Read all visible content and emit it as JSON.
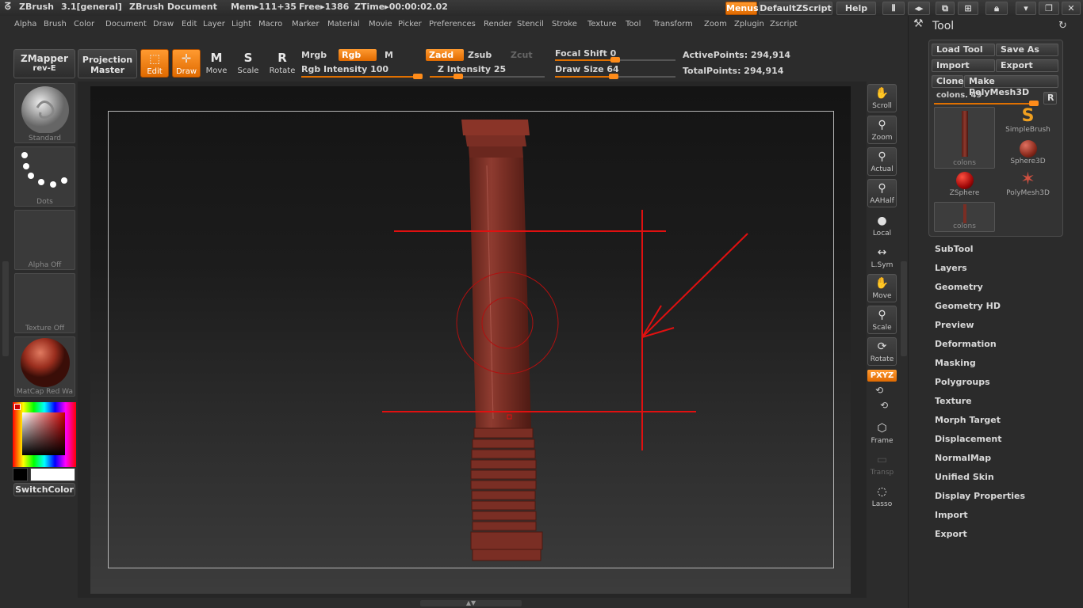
{
  "title_bar": {
    "app": "ZBrush",
    "version": "3.1[general]",
    "document": "ZBrush Document",
    "mem": "Mem▸111+35",
    "free": "Free▸1386",
    "ztime": "ZTime▸00:00:02.02",
    "menus_btn": "Menus",
    "script_btn": "DefaultZScript",
    "help_btn": "Help"
  },
  "menu_bar": [
    "Alpha",
    "Brush",
    "Color",
    "Document",
    "Draw",
    "Edit",
    "Layer",
    "Light",
    "Macro",
    "Marker",
    "Material",
    "Movie",
    "Picker",
    "Preferences",
    "Render",
    "Stencil",
    "Stroke",
    "Texture",
    "Tool",
    "Transform",
    "Zoom",
    "Zplugin",
    "Zscript"
  ],
  "toolbar": {
    "zmapper": "ZMapper",
    "zmapper_sub": "rev-E",
    "projection": "Projection",
    "projection_sub": "Master",
    "edit": "Edit",
    "draw": "Draw",
    "move": "Move",
    "scale": "Scale",
    "rotate": "Rotate",
    "mrgb": "Mrgb",
    "rgb": "Rgb",
    "m": "M",
    "rgb_intensity": "Rgb Intensity 100",
    "zadd": "Zadd",
    "zsub": "Zsub",
    "zcut": "Zcut",
    "z_intensity": "Z Intensity 25",
    "focal_shift": "Focal Shift 0",
    "draw_size": "Draw Size 64",
    "active_points": "ActivePoints: 294,914",
    "total_points": "TotalPoints: 294,914",
    "rgb_intensity_value": 100,
    "z_intensity_value": 25,
    "focal_shift_value": 0,
    "draw_size_value": 64
  },
  "left_shelf": {
    "brush": "Standard",
    "stroke": "Dots",
    "alpha": "Alpha  Off",
    "texture": "Texture  Off",
    "material": "MatCap  Red  Wa",
    "switch_color": "SwitchColor"
  },
  "right_strip": [
    "Scroll",
    "Zoom",
    "Actual",
    "AAHalf",
    "Local",
    "L.Sym",
    "Move",
    "Scale",
    "Rotate",
    "PXYZ",
    "Frame",
    "Transp",
    "Lasso"
  ],
  "palette": {
    "title": "Tool",
    "load_tool": "Load Tool",
    "save_as": "Save As",
    "import": "Import",
    "export": "Export",
    "clone": "Clone",
    "make_polymesh": "Make PolyMesh3D",
    "colons_slider": "colons. 49",
    "r_btn": "R",
    "tiles": [
      "colons",
      "SimpleBrush",
      "Sphere3D",
      "ZSphere",
      "PolyMesh3D",
      "colons"
    ],
    "sections": [
      "SubTool",
      "Layers",
      "Geometry",
      "Geometry HD",
      "Preview",
      "Deformation",
      "Masking",
      "Polygroups",
      "Texture",
      "Morph Target",
      "Displacement",
      "NormalMap",
      "Unified Skin",
      "Display Properties",
      "Import",
      "Export"
    ]
  },
  "colors": {
    "accent": "#ff8c1a",
    "column": "#8a3a30",
    "annotation": "#e01010"
  }
}
